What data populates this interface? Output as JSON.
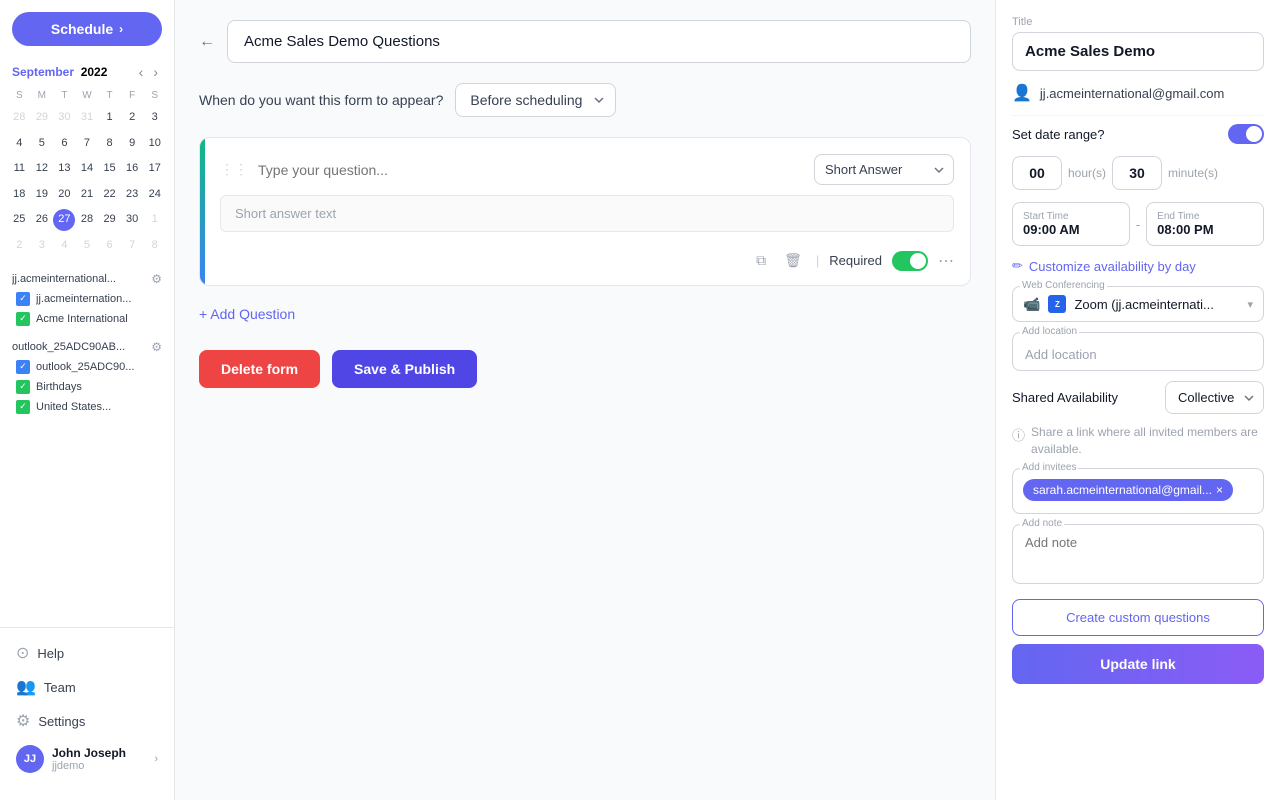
{
  "sidebar": {
    "schedule_btn": "Schedule",
    "calendar": {
      "month": "September",
      "year": "2022",
      "day_names": [
        "S",
        "M",
        "T",
        "W",
        "T",
        "F",
        "S"
      ],
      "weeks": [
        [
          "28",
          "29",
          "30",
          "31",
          "1",
          "2",
          "3"
        ],
        [
          "4",
          "5",
          "6",
          "7",
          "8",
          "9",
          "10"
        ],
        [
          "11",
          "12",
          "13",
          "14",
          "15",
          "16",
          "17"
        ],
        [
          "18",
          "19",
          "20",
          "21",
          "22",
          "23",
          "24"
        ],
        [
          "25",
          "26",
          "27",
          "28",
          "29",
          "30",
          "1"
        ],
        [
          "2",
          "3",
          "4",
          "5",
          "6",
          "7",
          "8"
        ]
      ],
      "other_month_days": [
        "28",
        "29",
        "30",
        "31",
        "1",
        "2",
        "3",
        "8"
      ],
      "today": "27"
    },
    "accounts": [
      {
        "name": "jj.acmeinternational...",
        "items": [
          {
            "label": "jj.acmeinternation...",
            "color": "blue"
          },
          {
            "label": "Acme International",
            "color": "green"
          }
        ]
      },
      {
        "name": "outlook_25ADC90AB...",
        "items": [
          {
            "label": "outlook_25ADC90...",
            "color": "blue"
          },
          {
            "label": "Birthdays",
            "color": "green"
          },
          {
            "label": "United States...",
            "color": "green"
          }
        ]
      }
    ],
    "bottom_items": [
      {
        "icon": "?",
        "label": "Help"
      },
      {
        "icon": "👥",
        "label": "Team"
      },
      {
        "icon": "⚙",
        "label": "Settings"
      }
    ],
    "user": {
      "initials": "JJ",
      "name": "John Joseph",
      "handle": "jjdemo"
    }
  },
  "main": {
    "form_title": "Acme Sales Demo Questions",
    "form_appear_label": "When do you want this form to appear?",
    "form_appear_option": "Before scheduling",
    "question_placeholder": "Type your question...",
    "question_type": "Short Answer",
    "answer_preview": "Short answer text",
    "required_label": "Required",
    "add_question_label": "+ Add Question",
    "delete_btn": "Delete form",
    "save_btn": "Save & Publish"
  },
  "right_panel": {
    "title_label": "Title",
    "title_value": "Acme Sales Demo",
    "email": "jj.acmeinternational@gmail.com",
    "set_date_range_label": "Set date range?",
    "hours_value": "00",
    "hours_unit": "hour(s)",
    "minutes_value": "30",
    "minutes_unit": "minute(s)",
    "start_time_label": "Start Time",
    "start_time_value": "09:00 AM",
    "end_time_label": "End Time",
    "end_time_value": "08:00 PM",
    "customize_label": "Customize availability by day",
    "web_conf_label": "Web Conferencing",
    "zoom_name": "Zoom (jj.acmeinternati...",
    "location_label": "Add location",
    "location_placeholder": "Add location",
    "shared_avail_label": "Shared Availability",
    "collective_value": "Collective",
    "info_text": "Share a link where all invited members are available.",
    "invitees_label": "Add invitees",
    "invitee_chip": "sarah.acmeinternational@gmail...",
    "note_placeholder": "Add note",
    "create_questions_btn": "Create custom questions",
    "update_link_btn": "Update link"
  }
}
